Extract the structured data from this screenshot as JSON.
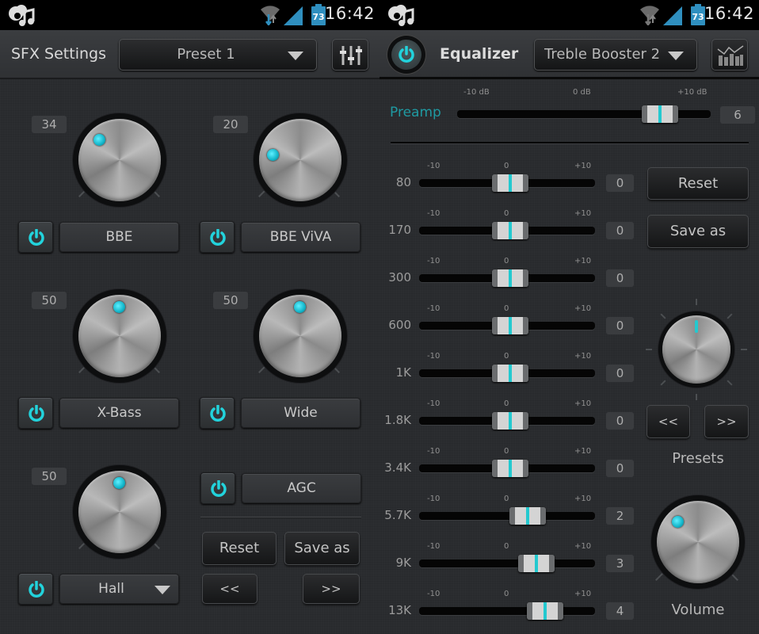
{
  "status_bar": {
    "time": "16:42",
    "battery": "73"
  },
  "sfx_panel": {
    "title": "SFX Settings",
    "preset_dropdown": "Preset 1",
    "mixer_button_icon": "mixer-sliders-icon",
    "effects": [
      {
        "name": "BBE",
        "knob_value": "34",
        "enabled": true
      },
      {
        "name": "BBE ViVA",
        "knob_value": "20",
        "enabled": true
      },
      {
        "name": "X-Bass",
        "knob_value": "50",
        "enabled": true
      },
      {
        "name": "Wide",
        "knob_value": "50",
        "enabled": true
      },
      {
        "name": "Hall",
        "knob_value": "50",
        "enabled": true,
        "is_dropdown": true
      }
    ],
    "agc": {
      "label": "AGC",
      "enabled": true
    },
    "reset_label": "Reset",
    "save_as_label": "Save as",
    "prev_label": "<<",
    "next_label": ">>"
  },
  "eq_panel": {
    "title": "Equalizer",
    "power_on": true,
    "preset_dropdown": "Treble Booster 2",
    "graph_button_icon": "eq-graph-icon",
    "preamp": {
      "label": "Preamp",
      "scale": [
        "-10 dB",
        "0 dB",
        "+10 dB"
      ],
      "value": "6",
      "numeric": 6,
      "min": -10,
      "max": 10
    },
    "band_scale": [
      "-10",
      "0",
      "+10"
    ],
    "bands": [
      {
        "freq": "80",
        "value": "0",
        "numeric": 0
      },
      {
        "freq": "170",
        "value": "0",
        "numeric": 0
      },
      {
        "freq": "300",
        "value": "0",
        "numeric": 0
      },
      {
        "freq": "600",
        "value": "0",
        "numeric": 0
      },
      {
        "freq": "1K",
        "value": "0",
        "numeric": 0
      },
      {
        "freq": "1.8K",
        "value": "0",
        "numeric": 0
      },
      {
        "freq": "3.4K",
        "value": "0",
        "numeric": 0
      },
      {
        "freq": "5.7K",
        "value": "2",
        "numeric": 2
      },
      {
        "freq": "9K",
        "value": "3",
        "numeric": 3
      },
      {
        "freq": "13K",
        "value": "4",
        "numeric": 4
      }
    ],
    "reset_label": "Reset",
    "save_as_label": "Save as",
    "presets_label": "Presets",
    "prev_label": "<<",
    "next_label": ">>",
    "volume_label": "Volume"
  },
  "colors": {
    "accent": "#23c9cf",
    "background": "#2a2c2f",
    "text": "#c4c4c4"
  }
}
